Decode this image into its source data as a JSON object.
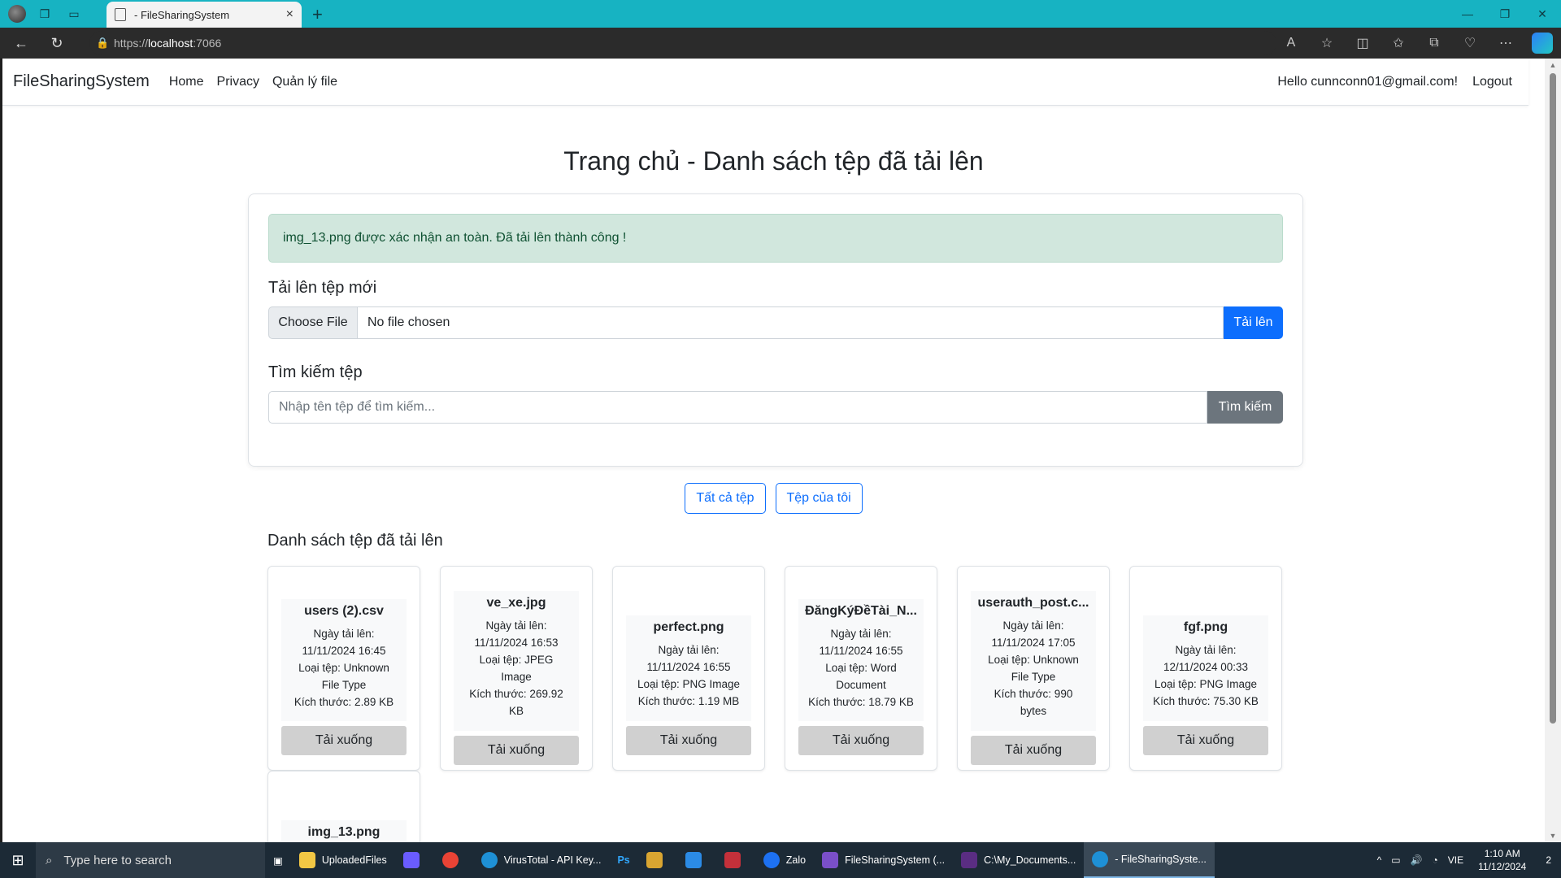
{
  "browser": {
    "tab_title": "- FileSharingSystem",
    "tab_close": "×",
    "new_tab": "+",
    "url_scheme": "https://",
    "url_host": "localhost",
    "url_port": ":7066",
    "window_controls": [
      "—",
      "❐",
      "✕"
    ],
    "profile_icon": "profile-avatar",
    "toolbar_icons": [
      "read-aloud-icon",
      "favorite-star-icon",
      "split-screen-icon",
      "favorites-icon",
      "collections-icon",
      "browser-essentials-icon",
      "more-icon",
      "copilot-icon"
    ]
  },
  "navbar": {
    "brand": "FileSharingSystem",
    "links": [
      "Home",
      "Privacy",
      "Quản lý file"
    ],
    "greeting": "Hello cunnconn01@gmail.com!",
    "logout": "Logout"
  },
  "page": {
    "title": "Trang chủ - Danh sách tệp đã tải lên",
    "alert": "img_13.png được xác nhận an toàn. Đã tải lên thành công !",
    "upload": {
      "heading": "Tải lên tệp mới",
      "choose_label": "Choose File",
      "file_status": "No file chosen",
      "button": "Tải lên"
    },
    "search": {
      "heading": "Tìm kiếm tệp",
      "placeholder": "Nhập tên tệp để tìm kiếm...",
      "button": "Tìm kiếm"
    },
    "filters": {
      "all": "Tất cả tệp",
      "mine": "Tệp của tôi"
    },
    "list_title": "Danh sách tệp đã tải lên",
    "download_label": "Tải xuống",
    "files": [
      {
        "name": "users (2).csv",
        "lines": [
          "Ngày tải lên:",
          "11/11/2024 16:45",
          "Loại tệp: Unknown",
          "File Type",
          "Kích thước: 2.89 KB"
        ]
      },
      {
        "name": "ve_xe.jpg",
        "lines": [
          "Ngày tải lên:",
          "11/11/2024 16:53",
          "Loại tệp: JPEG",
          "Image",
          "Kích thước: 269.92",
          "KB"
        ]
      },
      {
        "name": "perfect.png",
        "lines": [
          "Ngày tải lên:",
          "11/11/2024 16:55",
          "Loại tệp: PNG Image",
          "Kích thước: 1.19 MB"
        ]
      },
      {
        "name": "ĐăngKýĐềTài_N...",
        "lines": [
          "Ngày tải lên:",
          "11/11/2024 16:55",
          "Loại tệp: Word",
          "Document",
          "Kích thước: 18.79 KB"
        ]
      },
      {
        "name": "userauth_post.c...",
        "lines": [
          "Ngày tải lên:",
          "11/11/2024 17:05",
          "Loại tệp: Unknown",
          "File Type",
          "Kích thước: 990",
          "bytes"
        ]
      },
      {
        "name": "fgf.png",
        "lines": [
          "Ngày tải lên:",
          "12/11/2024 00:33",
          "Loại tệp: PNG Image",
          "Kích thước: 75.30 KB"
        ]
      },
      {
        "name": "img_13.png",
        "lines": []
      }
    ]
  },
  "taskbar": {
    "search_placeholder": "Type here to search",
    "items": [
      {
        "label": "UploadedFiles",
        "color": "#f2c744"
      },
      {
        "label": "",
        "color": "#6a5cff"
      },
      {
        "label": "",
        "color": "#e94335"
      },
      {
        "label": "VirusTotal - API Key...",
        "color": "#1e90d6"
      },
      {
        "label": "Ps",
        "color": "#0e2a47"
      },
      {
        "label": "",
        "color": "#d9a531"
      },
      {
        "label": "",
        "color": "#2b8be6"
      },
      {
        "label": "",
        "color": "#c4303a"
      },
      {
        "label": "Zalo",
        "color": "#1d71f2"
      },
      {
        "label": "FileSharingSystem (...",
        "color": "#7a4fc9"
      },
      {
        "label": "C:\\My_Documents...",
        "color": "#5a2d82"
      },
      {
        "label": "- FileSharingSyste...",
        "color": "#1e90d6"
      }
    ],
    "lang": "VIE",
    "time": "1:10 AM",
    "date": "11/12/2024",
    "notifications": "2"
  }
}
